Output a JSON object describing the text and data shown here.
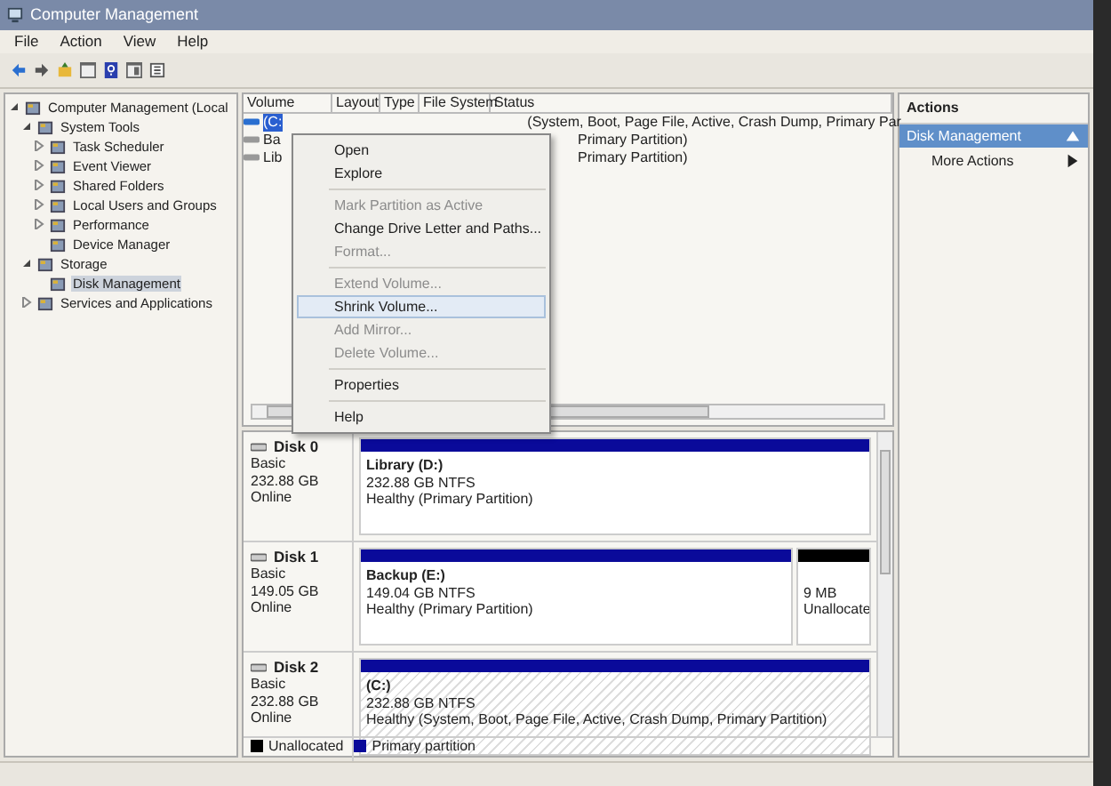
{
  "window": {
    "title": "Computer Management"
  },
  "menu": [
    "File",
    "Action",
    "View",
    "Help"
  ],
  "tree": {
    "label": "Computer Management (Local",
    "expanded": true,
    "selected": false,
    "children": [
      {
        "label": "System Tools",
        "expanded": true,
        "selected": false,
        "children": [
          {
            "label": "Task Scheduler",
            "expanded": false,
            "selected": false
          },
          {
            "label": "Event Viewer",
            "expanded": false,
            "selected": false
          },
          {
            "label": "Shared Folders",
            "expanded": false,
            "selected": false
          },
          {
            "label": "Local Users and Groups",
            "expanded": false,
            "selected": false
          },
          {
            "label": "Performance",
            "expanded": false,
            "selected": false
          },
          {
            "label": "Device Manager",
            "selected": false
          }
        ]
      },
      {
        "label": "Storage",
        "expanded": true,
        "selected": false,
        "children": [
          {
            "label": "Disk Management",
            "selected": true
          }
        ]
      },
      {
        "label": "Services and Applications",
        "expanded": false,
        "selected": false
      }
    ]
  },
  "volume_table": {
    "columns": [
      "Volume",
      "Layout",
      "Type",
      "File System",
      "Status"
    ],
    "rows": [
      {
        "volume": "(C:",
        "status": "(System, Boot, Page File, Active, Crash Dump, Primary Par",
        "selected": true
      },
      {
        "volume": "Ba",
        "status": "Primary Partition)",
        "selected": false
      },
      {
        "volume": "Lib",
        "status": "Primary Partition)",
        "selected": false
      }
    ]
  },
  "context_menu": [
    {
      "label": "Open",
      "disabled": false,
      "selected": false
    },
    {
      "label": "Explore",
      "disabled": false,
      "selected": false,
      "separator_after": true
    },
    {
      "label": "Mark Partition as Active",
      "disabled": true,
      "selected": false
    },
    {
      "label": "Change Drive Letter and Paths...",
      "disabled": false,
      "selected": false
    },
    {
      "label": "Format...",
      "disabled": true,
      "selected": false,
      "separator_after": true
    },
    {
      "label": "Extend Volume...",
      "disabled": true,
      "selected": false
    },
    {
      "label": "Shrink Volume...",
      "disabled": false,
      "selected": true
    },
    {
      "label": "Add Mirror...",
      "disabled": true,
      "selected": false
    },
    {
      "label": "Delete Volume...",
      "disabled": true,
      "selected": false,
      "separator_after": true
    },
    {
      "label": "Properties",
      "disabled": false,
      "selected": false,
      "separator_after": true
    },
    {
      "label": "Help",
      "disabled": false,
      "selected": false
    }
  ],
  "disks": [
    {
      "name": "Disk 0",
      "type": "Basic",
      "size": "232.88 GB",
      "state": "Online",
      "partitions": [
        {
          "kind": "primary",
          "name": "Library  (D:)",
          "size": "232.88 GB NTFS",
          "status": "Healthy (Primary Partition)",
          "selected": false
        }
      ]
    },
    {
      "name": "Disk 1",
      "type": "Basic",
      "size": "149.05 GB",
      "state": "Online",
      "partitions": [
        {
          "kind": "primary",
          "name": "Backup  (E:)",
          "size": "149.04 GB NTFS",
          "status": "Healthy (Primary Partition)",
          "selected": false
        },
        {
          "kind": "unallocated",
          "size": "9 MB",
          "status": "Unallocate",
          "selected": false
        }
      ]
    },
    {
      "name": "Disk 2",
      "type": "Basic",
      "size": "232.88 GB",
      "state": "Online",
      "partitions": [
        {
          "kind": "primary",
          "name": "(C:)",
          "size": "232.88 GB NTFS",
          "status": "Healthy (System, Boot, Page File, Active, Crash Dump, Primary Partition)",
          "selected": true
        }
      ]
    }
  ],
  "legend": [
    {
      "label": "Unallocated",
      "color": "#000000"
    },
    {
      "label": "Primary partition",
      "color": "#0a0a9a"
    }
  ],
  "actions": {
    "title": "Actions",
    "section": "Disk Management",
    "items": [
      "More Actions"
    ]
  }
}
